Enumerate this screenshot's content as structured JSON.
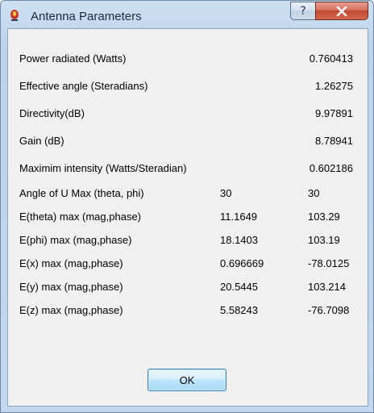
{
  "window": {
    "title": "Antenna Parameters",
    "help_label": "?"
  },
  "params": [
    {
      "label": "Power radiated (Watts)",
      "value": "0.760413"
    },
    {
      "label": "Effective angle (Steradians)",
      "value": "1.26275"
    },
    {
      "label": "Directivity(dB)",
      "value": "9.97891"
    },
    {
      "label": "Gain (dB)",
      "value": "8.78941"
    },
    {
      "label": "Maximim intensity (Watts/Steradian)",
      "value": "0.602186"
    }
  ],
  "pairs": [
    {
      "label": "Angle of U Max (theta, phi)",
      "v1": "30",
      "v2": "30"
    },
    {
      "label": "E(theta) max (mag,phase)",
      "v1": "11.1649",
      "v2": "103.29"
    },
    {
      "label": "E(phi) max (mag,phase)",
      "v1": "18.1403",
      "v2": "103.19"
    },
    {
      "label": "E(x) max (mag,phase)",
      "v1": "0.696669",
      "v2": "-78.0125"
    },
    {
      "label": "E(y) max (mag,phase)",
      "v1": "20.5445",
      "v2": "103.214"
    },
    {
      "label": "E(z) max (mag,phase)",
      "v1": "5.58243",
      "v2": "-76.7098"
    }
  ],
  "buttons": {
    "ok_label": "OK"
  }
}
